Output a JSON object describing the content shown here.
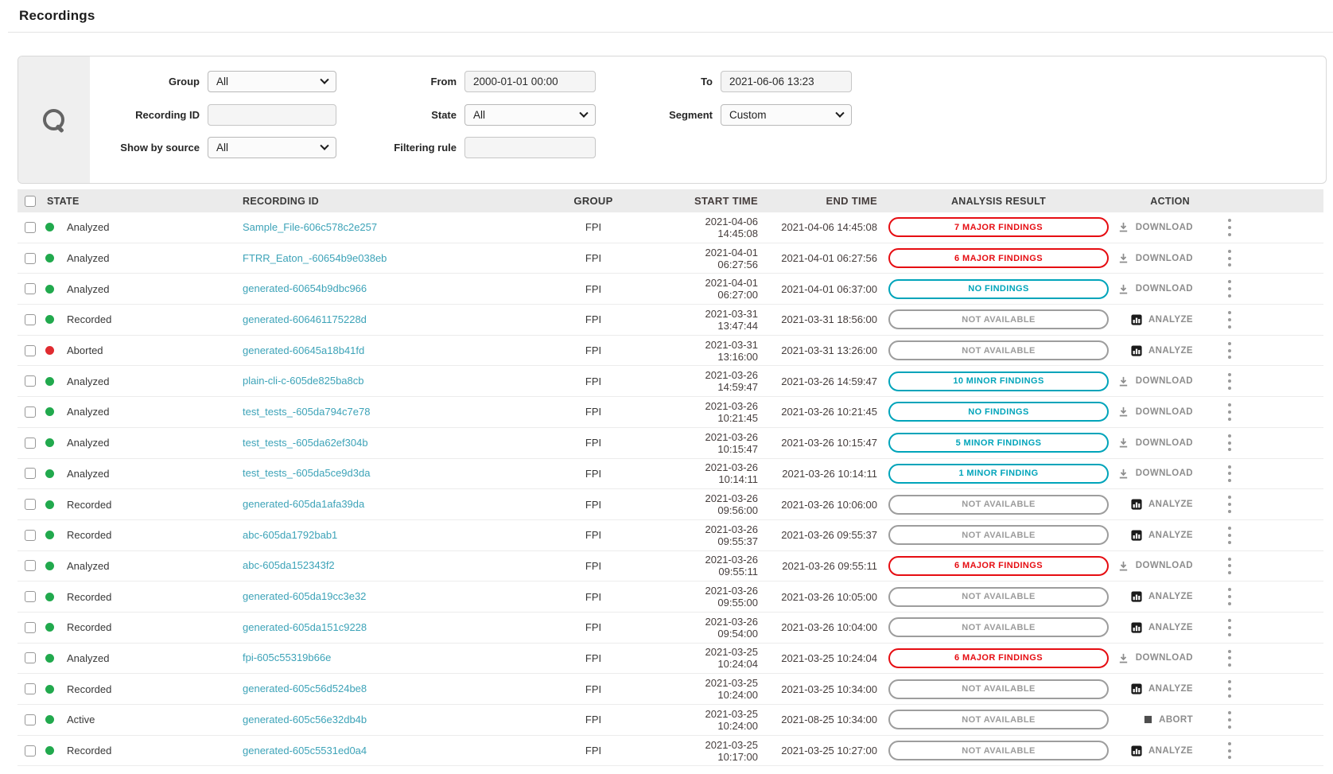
{
  "page": {
    "title": "Recordings"
  },
  "icons": {
    "search": "magnifier-icon",
    "select_chevron": "chevron-down-icon",
    "download": "download-icon",
    "analyze": "bar-chart-icon",
    "abort": "stop-square-icon",
    "row_menu": "kebab-menu-icon"
  },
  "colors": {
    "badge_major": "#e60d12",
    "badge_minor": "#00a4ba",
    "badge_na": "#9d9d9d",
    "link_teal": "#3da3b8",
    "dot_green": "#21a94d",
    "dot_red": "#e02b30",
    "header_bg": "#ebebeb",
    "action_gray": "#8d8d8d"
  },
  "filters": {
    "group": {
      "label": "Group",
      "value": "All"
    },
    "recording_id": {
      "label": "Recording ID",
      "value": ""
    },
    "show_by_source": {
      "label": "Show by source",
      "value": "All"
    },
    "from": {
      "label": "From",
      "value": "2000-01-01 00:00"
    },
    "state": {
      "label": "State",
      "value": "All"
    },
    "filtering_rule": {
      "label": "Filtering rule",
      "value": ""
    },
    "to": {
      "label": "To",
      "value": "2021-06-06 13:23"
    },
    "segment": {
      "label": "Segment",
      "value": "Custom"
    }
  },
  "table": {
    "headers": {
      "state": "STATE",
      "recording_id": "RECORDING ID",
      "group": "GROUP",
      "start_time": "START TIME",
      "end_time": "END TIME",
      "analysis_result": "ANALYSIS RESULT",
      "action": "ACTION"
    },
    "rows": [
      {
        "state": "Analyzed",
        "state_color": "green",
        "recording_id": "Sample_File-606c578c2e257",
        "group": "FPI",
        "start_time": "2021-04-06 14:45:08",
        "end_time": "2021-04-06 14:45:08",
        "result": "7 MAJOR FINDINGS",
        "result_kind": "major",
        "action": "download",
        "action_label": "DOWNLOAD"
      },
      {
        "state": "Analyzed",
        "state_color": "green",
        "recording_id": "FTRR_Eaton_-60654b9e038eb",
        "group": "FPI",
        "start_time": "2021-04-01 06:27:56",
        "end_time": "2021-04-01 06:27:56",
        "result": "6 MAJOR FINDINGS",
        "result_kind": "major",
        "action": "download",
        "action_label": "DOWNLOAD"
      },
      {
        "state": "Analyzed",
        "state_color": "green",
        "recording_id": "generated-60654b9dbc966",
        "group": "FPI",
        "start_time": "2021-04-01 06:27:00",
        "end_time": "2021-04-01 06:37:00",
        "result": "NO FINDINGS",
        "result_kind": "info",
        "action": "download",
        "action_label": "DOWNLOAD"
      },
      {
        "state": "Recorded",
        "state_color": "green",
        "recording_id": "generated-606461175228d",
        "group": "FPI",
        "start_time": "2021-03-31 13:47:44",
        "end_time": "2021-03-31 18:56:00",
        "result": "NOT AVAILABLE",
        "result_kind": "na",
        "action": "analyze",
        "action_label": "ANALYZE"
      },
      {
        "state": "Aborted",
        "state_color": "red",
        "recording_id": "generated-60645a18b41fd",
        "group": "FPI",
        "start_time": "2021-03-31 13:16:00",
        "end_time": "2021-03-31 13:26:00",
        "result": "NOT AVAILABLE",
        "result_kind": "na",
        "action": "analyze",
        "action_label": "ANALYZE"
      },
      {
        "state": "Analyzed",
        "state_color": "green",
        "recording_id": "plain-cli-c-605de825ba8cb",
        "group": "FPI",
        "start_time": "2021-03-26 14:59:47",
        "end_time": "2021-03-26 14:59:47",
        "result": "10 MINOR FINDINGS",
        "result_kind": "info",
        "action": "download",
        "action_label": "DOWNLOAD"
      },
      {
        "state": "Analyzed",
        "state_color": "green",
        "recording_id": "test_tests_-605da794c7e78",
        "group": "FPI",
        "start_time": "2021-03-26 10:21:45",
        "end_time": "2021-03-26 10:21:45",
        "result": "NO FINDINGS",
        "result_kind": "info",
        "action": "download",
        "action_label": "DOWNLOAD"
      },
      {
        "state": "Analyzed",
        "state_color": "green",
        "recording_id": "test_tests_-605da62ef304b",
        "group": "FPI",
        "start_time": "2021-03-26 10:15:47",
        "end_time": "2021-03-26 10:15:47",
        "result": "5 MINOR FINDINGS",
        "result_kind": "info",
        "action": "download",
        "action_label": "DOWNLOAD"
      },
      {
        "state": "Analyzed",
        "state_color": "green",
        "recording_id": "test_tests_-605da5ce9d3da",
        "group": "FPI",
        "start_time": "2021-03-26 10:14:11",
        "end_time": "2021-03-26 10:14:11",
        "result": "1 MINOR FINDING",
        "result_kind": "info",
        "action": "download",
        "action_label": "DOWNLOAD"
      },
      {
        "state": "Recorded",
        "state_color": "green",
        "recording_id": "generated-605da1afa39da",
        "group": "FPI",
        "start_time": "2021-03-26 09:56:00",
        "end_time": "2021-03-26 10:06:00",
        "result": "NOT AVAILABLE",
        "result_kind": "na",
        "action": "analyze",
        "action_label": "ANALYZE"
      },
      {
        "state": "Recorded",
        "state_color": "green",
        "recording_id": "abc-605da1792bab1",
        "group": "FPI",
        "start_time": "2021-03-26 09:55:37",
        "end_time": "2021-03-26 09:55:37",
        "result": "NOT AVAILABLE",
        "result_kind": "na",
        "action": "analyze",
        "action_label": "ANALYZE"
      },
      {
        "state": "Analyzed",
        "state_color": "green",
        "recording_id": "abc-605da152343f2",
        "group": "FPI",
        "start_time": "2021-03-26 09:55:11",
        "end_time": "2021-03-26 09:55:11",
        "result": "6 MAJOR FINDINGS",
        "result_kind": "major",
        "action": "download",
        "action_label": "DOWNLOAD"
      },
      {
        "state": "Recorded",
        "state_color": "green",
        "recording_id": "generated-605da19cc3e32",
        "group": "FPI",
        "start_time": "2021-03-26 09:55:00",
        "end_time": "2021-03-26 10:05:00",
        "result": "NOT AVAILABLE",
        "result_kind": "na",
        "action": "analyze",
        "action_label": "ANALYZE"
      },
      {
        "state": "Recorded",
        "state_color": "green",
        "recording_id": "generated-605da151c9228",
        "group": "FPI",
        "start_time": "2021-03-26 09:54:00",
        "end_time": "2021-03-26 10:04:00",
        "result": "NOT AVAILABLE",
        "result_kind": "na",
        "action": "analyze",
        "action_label": "ANALYZE"
      },
      {
        "state": "Analyzed",
        "state_color": "green",
        "recording_id": "fpi-605c55319b66e",
        "group": "FPI",
        "start_time": "2021-03-25 10:24:04",
        "end_time": "2021-03-25 10:24:04",
        "result": "6 MAJOR FINDINGS",
        "result_kind": "major",
        "action": "download",
        "action_label": "DOWNLOAD"
      },
      {
        "state": "Recorded",
        "state_color": "green",
        "recording_id": "generated-605c56d524be8",
        "group": "FPI",
        "start_time": "2021-03-25 10:24:00",
        "end_time": "2021-03-25 10:34:00",
        "result": "NOT AVAILABLE",
        "result_kind": "na",
        "action": "analyze",
        "action_label": "ANALYZE"
      },
      {
        "state": "Active",
        "state_color": "green",
        "recording_id": "generated-605c56e32db4b",
        "group": "FPI",
        "start_time": "2021-03-25 10:24:00",
        "end_time": "2021-08-25 10:34:00",
        "result": "NOT AVAILABLE",
        "result_kind": "na",
        "action": "abort",
        "action_label": "ABORT"
      },
      {
        "state": "Recorded",
        "state_color": "green",
        "recording_id": "generated-605c5531ed0a4",
        "group": "FPI",
        "start_time": "2021-03-25 10:17:00",
        "end_time": "2021-03-25 10:27:00",
        "result": "NOT AVAILABLE",
        "result_kind": "na",
        "action": "analyze",
        "action_label": "ANALYZE"
      }
    ]
  }
}
